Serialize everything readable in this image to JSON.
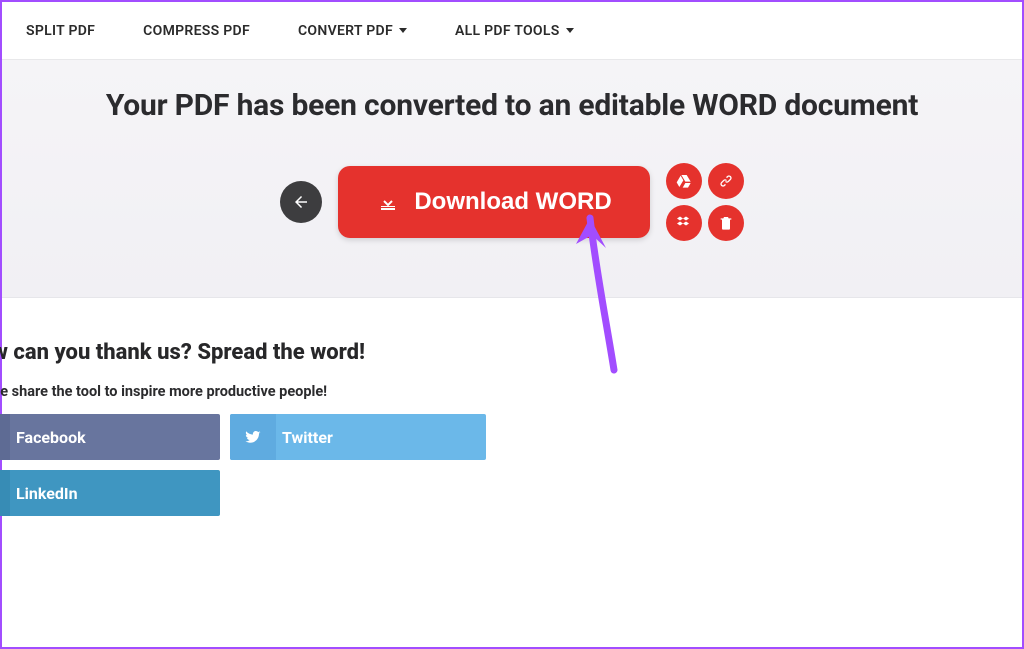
{
  "nav": {
    "split": "SPLIT PDF",
    "compress": "COMPRESS PDF",
    "convert": "CONVERT PDF",
    "all": "ALL PDF TOOLS"
  },
  "hero": {
    "title": "Your PDF has been converted to an editable WORD document",
    "download_label": "Download WORD"
  },
  "share": {
    "heading": "How can you thank us? Spread the word!",
    "subheading": "Please share the tool to inspire more productive people!",
    "facebook": "Facebook",
    "twitter": "Twitter",
    "linkedin": "LinkedIn"
  },
  "colors": {
    "primary_red": "#e5322d",
    "annotation_purple": "#a24dff",
    "facebook": "#68759e",
    "twitter": "#6bb8e9",
    "linkedin": "#3f96c1"
  }
}
